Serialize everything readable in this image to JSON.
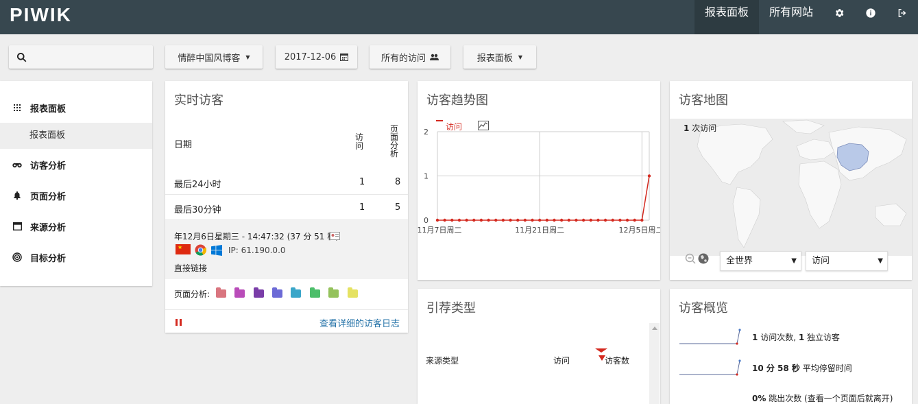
{
  "header": {
    "logo": "PIWIK",
    "nav": [
      "报表面板",
      "所有网站"
    ]
  },
  "toolbar": {
    "search_placeholder": "",
    "site": "情醉中国风博客",
    "date": "2017-12-06",
    "segment": "所有的访问",
    "dashboard": "报表面板"
  },
  "menu": {
    "items": [
      "报表面板",
      "访客分析",
      "页面分析",
      "来源分析",
      "目标分析"
    ],
    "sub_active": "报表面板"
  },
  "realtime": {
    "title": "实时访客",
    "col_date": "日期",
    "col_visits": "访\n问",
    "col_pages": "页\n面\n分\n析",
    "rows": [
      {
        "label": "最后24小时",
        "visits": "1",
        "pages": "8"
      },
      {
        "label": "最后30分钟",
        "visits": "1",
        "pages": "5"
      }
    ],
    "visit_time": "年12月6日星期三 - 14:47:32 (37 分 51 秒)",
    "visit_ip": "IP: 61.190.0.0",
    "visit_referrer": "直接链接",
    "pages_label": "页面分析:",
    "log_link": "查看详细的访客日志"
  },
  "trend": {
    "title": "访客趋势图",
    "legend": "访问",
    "chart_data": {
      "type": "line",
      "series": [
        {
          "name": "访问",
          "values": [
            0,
            0,
            0,
            0,
            0,
            0,
            0,
            0,
            0,
            0,
            0,
            0,
            0,
            0,
            0,
            0,
            0,
            0,
            0,
            0,
            0,
            0,
            0,
            0,
            0,
            0,
            0,
            0,
            0,
            1
          ]
        }
      ],
      "x_ticks": [
        "11月7日周二",
        "11月21日周二",
        "12月5日周二"
      ],
      "y_ticks": [
        "0",
        "1",
        "2"
      ],
      "ylim": [
        0,
        2
      ]
    }
  },
  "map": {
    "title": "访客地图",
    "visits_count": "1",
    "visits_label": "次访问",
    "region": "全世界",
    "metric": "访问"
  },
  "referrers": {
    "title": "引荐类型",
    "col_type": "来源类型",
    "col_visits": "访问",
    "col_visitors": "访客数"
  },
  "overview": {
    "title": "访客概览",
    "line1_a": "1",
    "line1_b": "访问次数,",
    "line1_c": "1",
    "line1_d": "独立访客",
    "line2_a": "10 分 58 秒",
    "line2_b": "平均停留时间",
    "line3_a": "0%",
    "line3_b": "跳出次数 (查看一个页面后就离开)"
  },
  "colors": {
    "topbar": "#37474f",
    "series": "#d4291f",
    "link": "#2573a8"
  }
}
